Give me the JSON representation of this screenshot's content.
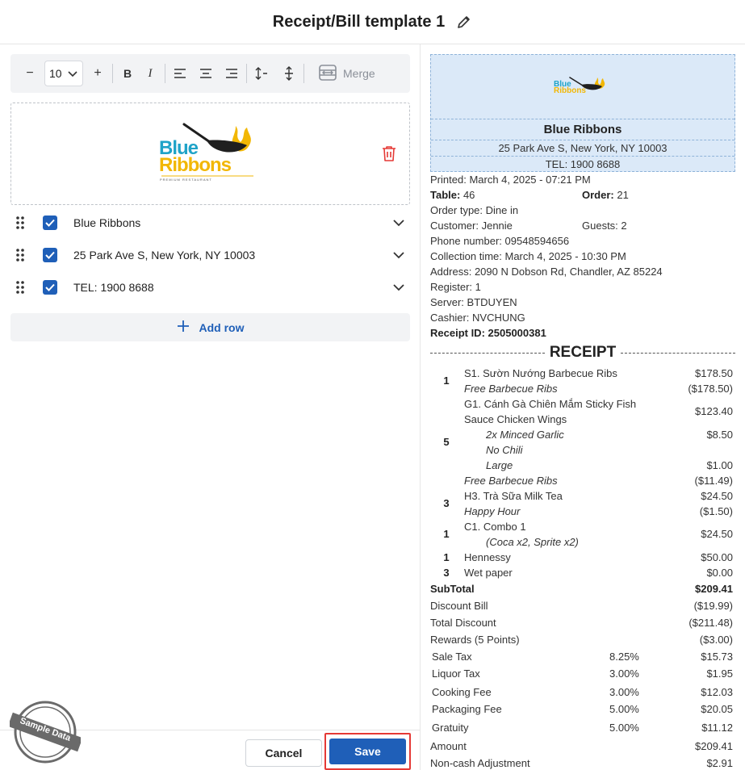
{
  "header": {
    "title": "Receipt/Bill template 1"
  },
  "toolbar": {
    "font_size": "10",
    "minus": "−",
    "plus": "+",
    "bold": "B",
    "italic": "I",
    "merge_label": "Merge"
  },
  "logo": {
    "line1": "Blue",
    "line2": "Ribbons",
    "tagline": "PREMIUM RESTAURANT"
  },
  "rows": [
    {
      "label": "Blue Ribbons"
    },
    {
      "label": "25 Park Ave S, New York, NY 10003"
    },
    {
      "label": "TEL: 1900 8688"
    }
  ],
  "add_row_label": "Add row",
  "footer": {
    "cancel_label": "Cancel",
    "save_label": "Save"
  },
  "stamp_text": "Sample Data",
  "receipt": {
    "name": "Blue Ribbons",
    "address": "25 Park Ave S, New York, NY 10003",
    "tel": "TEL: 1900 8688",
    "printed_label": "Printed:",
    "printed": "March 4, 2025 - 07:21 PM",
    "table_label": "Table:",
    "table": "46",
    "order_label": "Order:",
    "order": "21",
    "order_type_label": "Order type:",
    "order_type": "Dine in",
    "customer_label": "Customer:",
    "customer": "Jennie",
    "guests_label": "Guests:",
    "guests": "2",
    "phone_label": "Phone number:",
    "phone": "09548594656",
    "collection_label": "Collection time:",
    "collection": "March 4, 2025 - 10:30 PM",
    "address_label": "Address:",
    "address2": "2090 N Dobson Rd, Chandler, AZ 85224",
    "register_label": "Register:",
    "register": "1",
    "server_label": "Server:",
    "server": "BTDUYEN",
    "cashier_label": "Cashier:",
    "cashier": "NVCHUNG",
    "receipt_id_label": "Receipt ID:",
    "receipt_id": "2505000381",
    "section_title": "RECEIPT",
    "items": {
      "i1": {
        "qty": "1",
        "name": "S1. Sườn Nướng Barbecue Ribs",
        "price": "$178.50",
        "d1": "Free Barbecue Ribs",
        "d1p": "($178.50)"
      },
      "i2": {
        "qty": "5",
        "name1": "G1. Cánh Gà Chiên Mắm Sticky Fish",
        "name2": "Sauce Chicken Wings",
        "price": "$123.40",
        "m1": "2x Minced Garlic",
        "m1p": "$8.50",
        "m2": "No Chili",
        "m3": "Large",
        "m3p": "$1.00",
        "d1": "Free Barbecue Ribs",
        "d1p": "($11.49)"
      },
      "i3": {
        "qty": "3",
        "name": "H3. Trà Sữa Milk Tea",
        "price": "$24.50",
        "d1": "Happy Hour",
        "d1p": "($1.50)"
      },
      "i4": {
        "qty": "1",
        "name": "C1. Combo 1",
        "price": "$24.50",
        "m1": "(Coca x2, Sprite x2)"
      },
      "i5": {
        "qty": "1",
        "name": "Hennessy",
        "price": "$50.00"
      },
      "i6": {
        "qty": "3",
        "name": "Wet paper",
        "price": "$0.00"
      }
    },
    "totals": {
      "subtotal_label": "SubTotal",
      "subtotal": "$209.41",
      "discount_bill_label": "Discount Bill",
      "discount_bill": "($19.99)",
      "total_discount_label": "Total Discount",
      "total_discount": "($211.48)",
      "rewards_label": "Rewards (5 Points)",
      "rewards": "($3.00)",
      "sale_tax_label": "Sale Tax",
      "sale_tax_pct": "8.25%",
      "sale_tax": "$15.73",
      "liquor_tax_label": "Liquor Tax",
      "liquor_tax_pct": "3.00%",
      "liquor_tax": "$1.95",
      "cooking_fee_label": "Cooking Fee",
      "cooking_fee_pct": "3.00%",
      "cooking_fee": "$12.03",
      "packaging_fee_label": "Packaging Fee",
      "packaging_fee_pct": "5.00%",
      "packaging_fee": "$20.05",
      "gratuity_label": "Gratuity",
      "gratuity_pct": "5.00%",
      "gratuity": "$11.12",
      "amount_label": "Amount",
      "amount": "$209.41",
      "noncash_label": "Non-cash Adjustment",
      "noncash": "$2.91"
    }
  },
  "colors": {
    "primary": "#1f5fb8",
    "danger": "#e53935",
    "logo_teal": "#1fa3c8",
    "logo_gold": "#f2b705"
  }
}
